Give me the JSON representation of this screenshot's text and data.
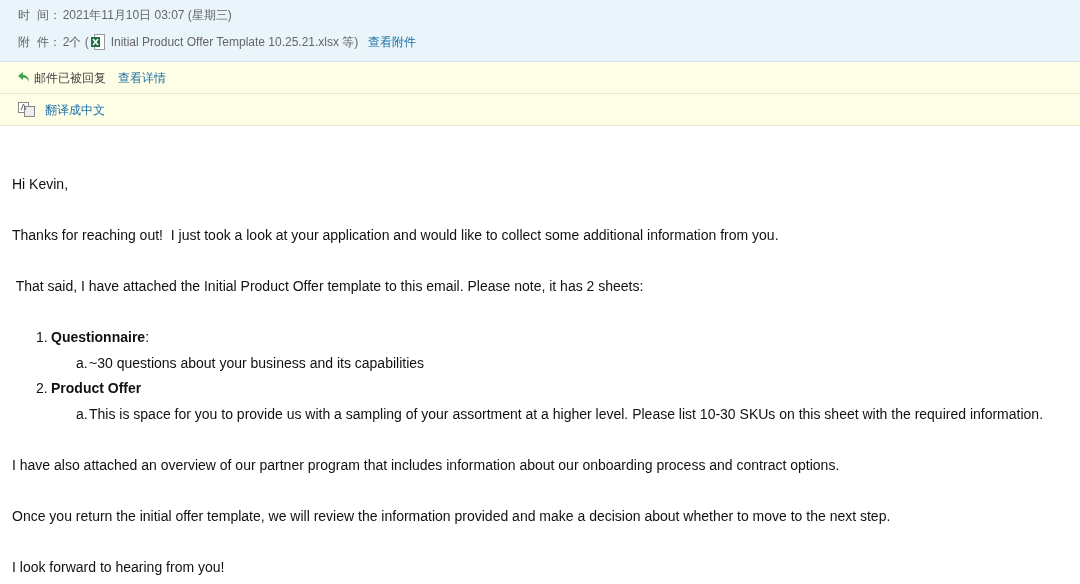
{
  "header": {
    "fields": [
      {
        "label": "时  间：",
        "value": "2021年11月10日 03:07 (星期三)"
      },
      {
        "label": "附  件：",
        "count": "2个 (",
        "file": "Initial Product Offer Template 10.25.21.xlsx 等)",
        "link": "查看附件"
      }
    ]
  },
  "notices": [
    {
      "kind": "replied",
      "text": "邮件已被回复",
      "link": "查看详情"
    },
    {
      "kind": "translate",
      "link": "翻译成中文"
    }
  ],
  "body": {
    "greeting": "Hi Kevin,",
    "paragraphs": [
      "Thanks for reaching out!  I just took a look at your application and would like to collect some additional information from you.",
      " That said, I have attached the Initial Product Offer template to this email. Please note, it has 2 sheets:"
    ],
    "list": [
      {
        "number": "1.",
        "text": "**Questionnaire**:",
        "sub": [
          {
            "letter": "a.",
            "text": "~30 questions about your business and its capabilities"
          }
        ]
      },
      {
        "number": "2.",
        "text": "**Product Offer**",
        "sub": [
          {
            "letter": "a.",
            "text": "This is space for you to provide us with a sampling of your assortment at a higher level. Please list 10-30 SKUs on this sheet with the required information."
          }
        ]
      }
    ],
    "closing": [
      "I have also attached an overview of our partner program that includes information about our onboarding process and contract options.",
      "Once you return the initial offer template, we will review the information provided and make a decision about whether to move to the next step.",
      "I look forward to hearing from you!"
    ]
  }
}
